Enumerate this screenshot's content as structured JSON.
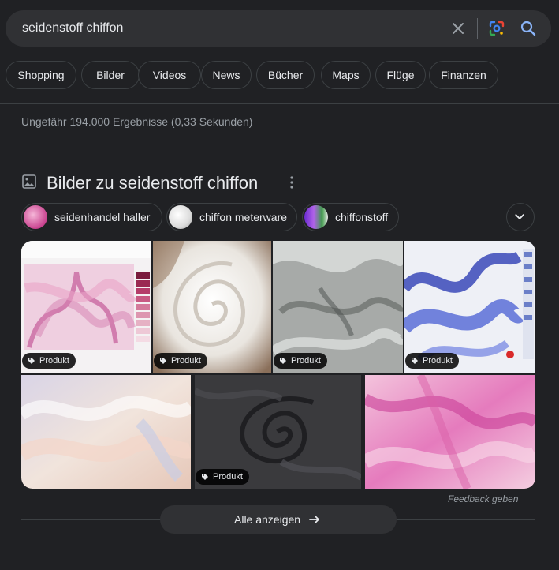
{
  "search": {
    "query": "seidenstoff chiffon",
    "clear_icon": "close-icon",
    "lens_icon": "google-lens-icon",
    "search_icon": "search-icon"
  },
  "tabs": [
    "Shopping",
    "Bilder",
    "Videos",
    "News",
    "Bücher",
    "Maps",
    "Flüge",
    "Finanzen"
  ],
  "stats": "Ungefähr 194.000 Ergebnisse (0,33 Sekunden)",
  "images_section": {
    "title": "Bilder zu seidenstoff chiffon",
    "refinements": [
      "seidenhandel haller",
      "chiffon meterware",
      "chiffonstoff"
    ],
    "badge_label": "Produkt",
    "feedback": "Feedback geben",
    "show_all": "Alle anzeigen"
  },
  "colors": {
    "background": "#202124",
    "surface": "#303134",
    "border": "#3c4043",
    "text": "#e8eaed",
    "muted": "#9aa0a6"
  }
}
